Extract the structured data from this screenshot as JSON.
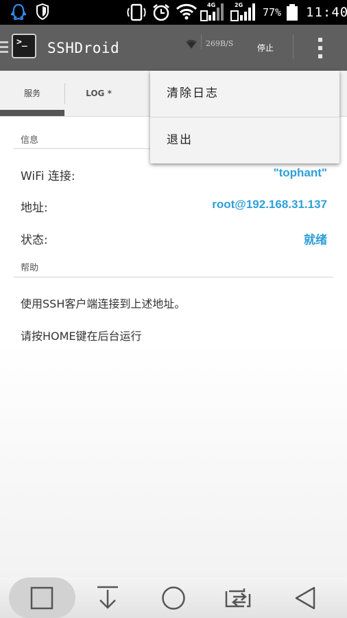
{
  "status_bar": {
    "icons": [
      "qq-icon",
      "shield-icon",
      "phone-rotate-icon",
      "alarm-icon",
      "wifi-icon",
      "signal-4g-icon",
      "signal-2g-icon",
      "battery-icon"
    ],
    "net1_label": "4G",
    "net2_label": "2G",
    "battery_percent": "77%",
    "time": "11:40"
  },
  "action_bar": {
    "title": "SSHDroid",
    "speed": "269B/S",
    "stop_label": "停止"
  },
  "tabs": [
    {
      "label": "服务",
      "selected": true
    },
    {
      "label": "LOG *",
      "selected": false
    }
  ],
  "info": {
    "header": "信息",
    "rows": [
      {
        "label": "WiFi 连接:",
        "value": "\"tophant\""
      },
      {
        "label": "地址:",
        "value": "root@192.168.31.137"
      },
      {
        "label": "状态:",
        "value": "就绪"
      }
    ]
  },
  "help": {
    "header": "帮助",
    "lines": [
      "使用SSH客户端连接到上述地址。",
      "请按HOME键在后台运行"
    ]
  },
  "menu": {
    "items": [
      "清除日志",
      "退出"
    ]
  },
  "nav_bar": {
    "buttons": [
      "recent-apps",
      "notifications-down",
      "home",
      "switch-apps",
      "back"
    ]
  },
  "colors": {
    "accent": "#2e9fd8",
    "action_bar": "#5f5f5f",
    "status_bar": "#000000"
  }
}
